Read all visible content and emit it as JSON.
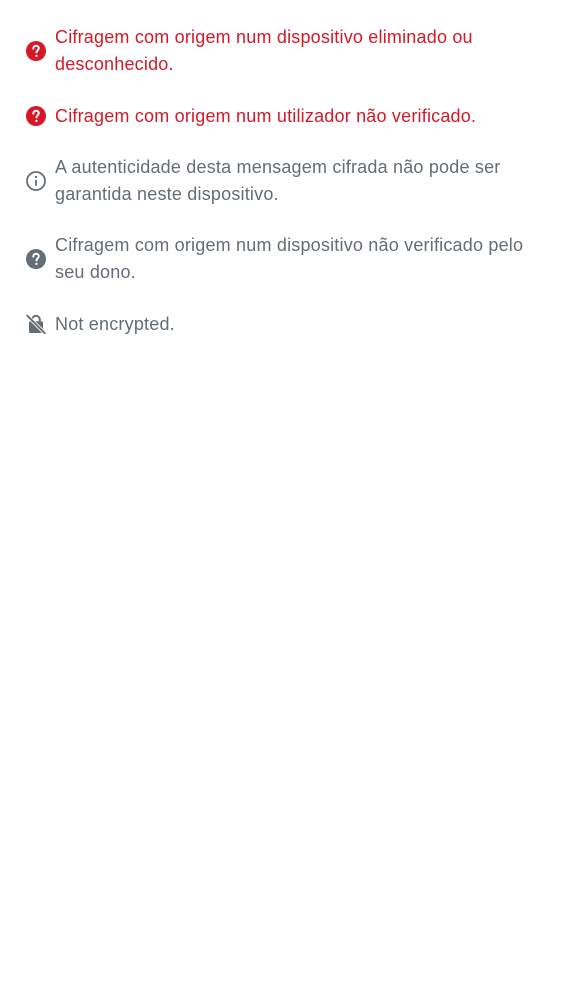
{
  "colors": {
    "critical": "#d51928",
    "neutral": "#656d77",
    "background": "#ffffff"
  },
  "shields": [
    {
      "icon": "help-solid-icon",
      "severity": "critical",
      "text": "Cifragem com origem num dispositivo eliminado ou desconhecido."
    },
    {
      "icon": "help-solid-icon",
      "severity": "critical",
      "text": "Cifragem com origem num utilizador não verificado."
    },
    {
      "icon": "info-outline-icon",
      "severity": "neutral",
      "text": "A autenticidade desta mensagem cifrada não pode ser garantida neste dispositivo."
    },
    {
      "icon": "help-solid-icon",
      "severity": "neutral",
      "text": "Cifragem com origem num dispositivo não verificado pelo seu dono."
    },
    {
      "icon": "lock-off-icon",
      "severity": "neutral",
      "text": "Not encrypted."
    }
  ]
}
